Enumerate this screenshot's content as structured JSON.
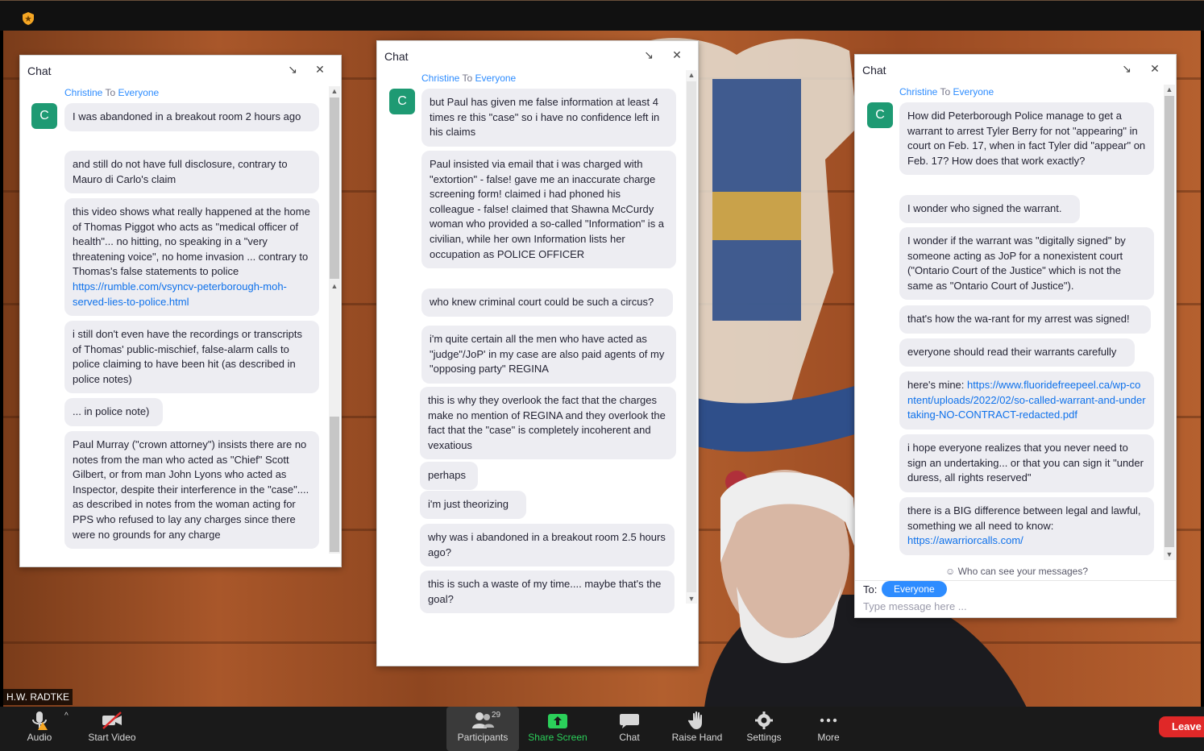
{
  "window": {
    "participant_name": "H.W. RADTKE"
  },
  "panels": [
    {
      "title": "Chat",
      "sender": {
        "from": "Christine",
        "to_word": "To",
        "to": "Everyone",
        "avatar": "C"
      },
      "messages": [
        {
          "text": "I was abandoned in a breakout room 2 hours ago"
        },
        {
          "text": "and still do not have full disclosure, contrary to Mauro di Carlo's claim"
        },
        {
          "text": "this video shows what really happened at the home of Thomas Piggot who acts as \"medical officer of health\"... no hitting, no speaking in a \"very threatening voice\", no home invasion ... contrary to Thomas's false statements to police",
          "link": "https://rumble.com/vsyncv-peterborough-moh-served-lies-to-police.html"
        },
        {
          "text": "i still don't even have the recordings or transcripts of Thomas' public-mischief, false-alarm calls to police claiming to have been hit (as described in police notes)"
        },
        {
          "text": "... in police note)"
        },
        {
          "text": "Paul Murray (\"crown attorney\") insists there are no notes from the man who acted as \"Chief\" Scott Gilbert, or from man John Lyons who acted as Inspector, despite their interference in the \"case\".... as described in notes from the woman acting for PPS who refused to lay any charges since there were no grounds for any charge"
        }
      ]
    },
    {
      "title": "Chat",
      "sender": {
        "from": "Christine",
        "to_word": "To",
        "to": "Everyone",
        "avatar": "C"
      },
      "messages": [
        {
          "text": "but Paul has given me false information at least 4 times re this \"case\" so i have no confidence left in his claims"
        },
        {
          "text": "Paul insisted via email that i was charged with \"extortion\" - false! gave me an inaccurate charge screening form! claimed i had phoned his colleague - false! claimed that Shawna McCurdy woman who provided a so-called \"Information\" is a civilian, while her own Information lists her occupation as POLICE OFFICER"
        },
        {
          "text": "who knew criminal court could be such a circus?"
        },
        {
          "text": "i'm quite certain all the men who have acted as \"judge\"/JoP' in my case are also paid agents of my \"opposing party\" REGINA"
        },
        {
          "text": "this is why they overlook the fact that the charges make no mention of REGINA and they overlook the fact that the \"case\" is completely incoherent and vexatious"
        },
        {
          "text": "perhaps"
        },
        {
          "text": "i'm just theorizing"
        },
        {
          "text": "why was i abandoned in a breakout room 2.5 hours ago?"
        },
        {
          "text": "this is such a waste of my time.... maybe that's the goal?"
        }
      ]
    },
    {
      "title": "Chat",
      "sender": {
        "from": "Christine",
        "to_word": "To",
        "to": "Everyone",
        "avatar": "C"
      },
      "messages": [
        {
          "text": "How did Peterborough Police manage to get a warrant to arrest Tyler Berry for not \"appearing\" in court on Feb. 17, when in fact Tyler did \"appear\" on Feb. 17? How does that work exactly?"
        },
        {
          "text": "I wonder who signed the warrant."
        },
        {
          "text": "I wonder if the warrant was \"digitally signed\" by someone acting as JoP for a nonexistent court (\"Ontario Court of the Justice\" which is not the same as \"Ontario Court of Justice\")."
        },
        {
          "text": "that's how the wa-rant for my arrest was signed!"
        },
        {
          "text": "everyone should read their warrants carefully"
        },
        {
          "text": "here's mine:",
          "link": "https://www.fluoridefreepeel.ca/wp-content/uploads/2022/02/so-called-warrant-and-undertaking-NO-CONTRACT-redacted.pdf"
        },
        {
          "text": "i hope everyone realizes that you never need to sign an undertaking... or that you can sign it \"under duress, all rights reserved\""
        },
        {
          "text": "there is a BIG difference between legal and lawful, something we all need to know:",
          "link": "https://awarriorcalls.com/"
        }
      ],
      "who_can_see": "Who can see your messages?",
      "to_label": "To:",
      "recipient": "Everyone",
      "input": {
        "placeholder": "Type message here ...",
        "value": ""
      }
    }
  ],
  "toolbar": {
    "audio": "Audio",
    "start_video": "Start Video",
    "participants": "Participants",
    "participant_count": "29",
    "share_screen": "Share Screen",
    "chat": "Chat",
    "raise_hand": "Raise Hand",
    "settings": "Settings",
    "more": "More",
    "leave": "Leave"
  },
  "colors": {
    "accent": "#2d8cff",
    "avatar": "#1e9a73",
    "share": "#2bd05a",
    "leave": "#e02828",
    "link": "#0e71eb"
  }
}
